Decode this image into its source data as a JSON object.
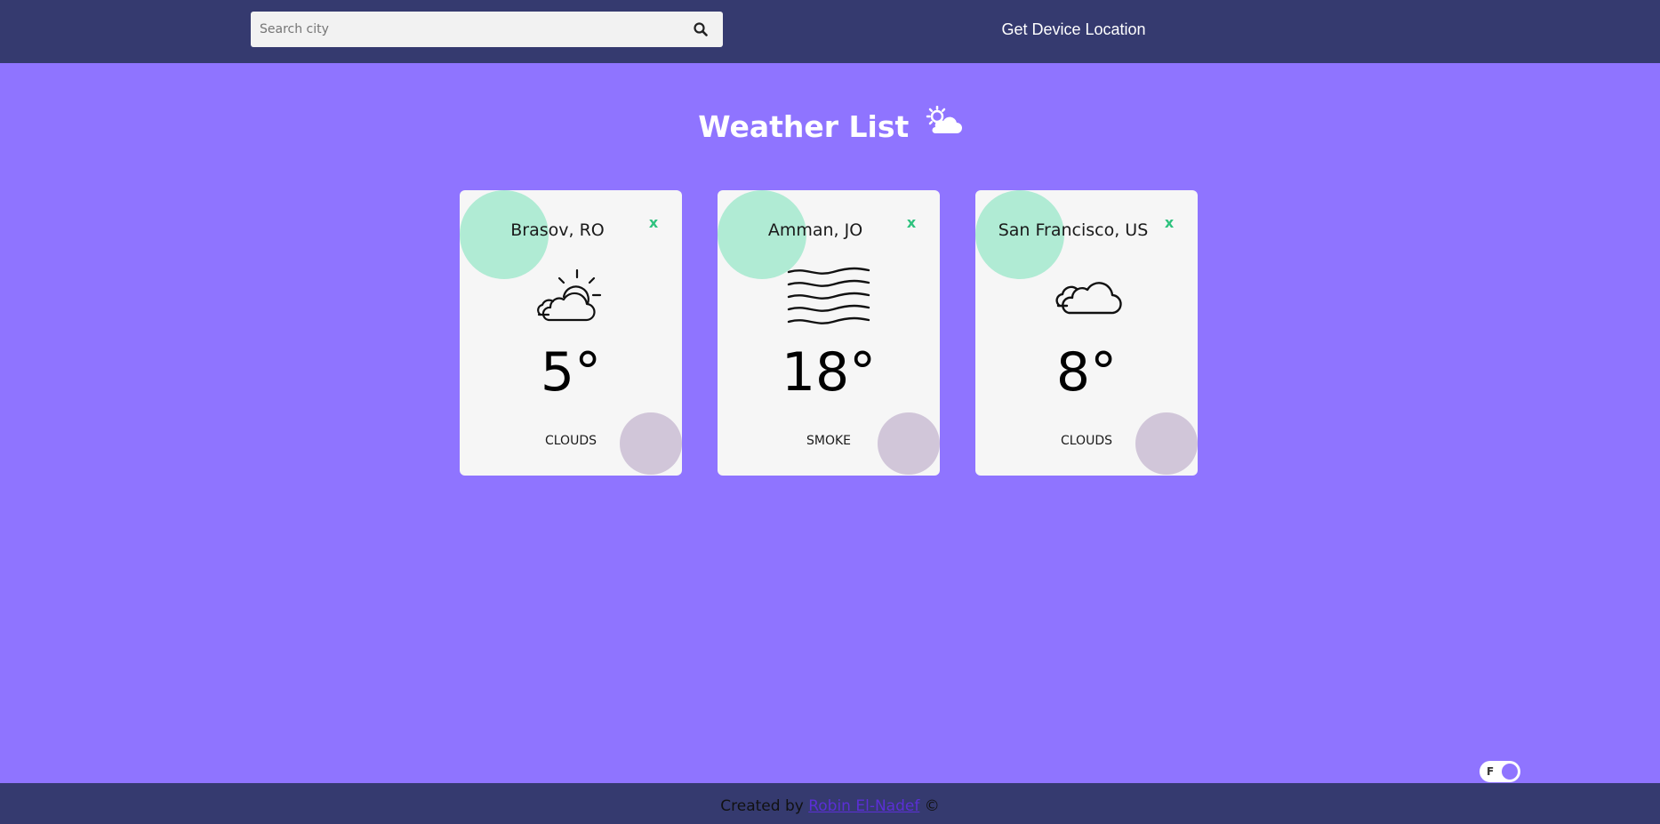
{
  "header": {
    "search_placeholder": "Search city",
    "search_value": "",
    "search_icon": "search-icon",
    "location_label": "Get Device Location"
  },
  "main": {
    "title": "Weather List",
    "title_icon": "sun-behind-cloud-icon",
    "cards": [
      {
        "city": "Brasov, RO",
        "close_label": "x",
        "icon": "partly-cloudy-icon",
        "temp": "5°",
        "condition": "CLOUDS"
      },
      {
        "city": "Amman, JO",
        "close_label": "x",
        "icon": "smoke-icon",
        "temp": "18°",
        "condition": "SMOKE"
      },
      {
        "city": "San Francisco, US",
        "close_label": "x",
        "icon": "cloud-icon",
        "temp": "8°",
        "condition": "CLOUDS"
      }
    ]
  },
  "toggle": {
    "label": "F"
  },
  "footer": {
    "prefix": "Created by",
    "author": "Robin El-Nadef",
    "suffix": "©"
  },
  "colors": {
    "page_background": "#8f74ff",
    "bar_background": "#353a6f",
    "card_background": "#f6f6f6",
    "accent_green": "#2ec27e",
    "blob_green": "#b0ebd4",
    "blob_mauve": "#d1c6d9"
  }
}
